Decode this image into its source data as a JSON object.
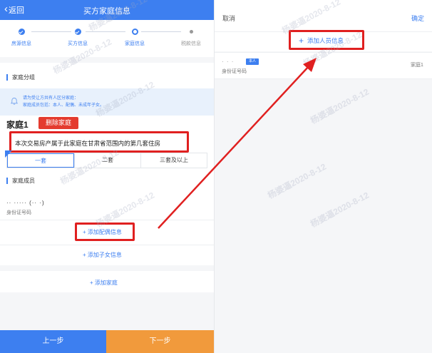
{
  "left": {
    "nav": {
      "back_label": "返回",
      "title": "买方家庭信息"
    },
    "steps": [
      {
        "label": "房源信息",
        "state": "done"
      },
      {
        "label": "买方信息",
        "state": "done"
      },
      {
        "label": "家庭信息",
        "state": "current"
      },
      {
        "label": "税款信息",
        "state": "todo"
      }
    ],
    "family_group_title": "家庭分组",
    "notice": {
      "line1": "请为受让方共有人区分家庭：",
      "line2": "家庭成员包括：本人、配偶、未成年子女。"
    },
    "family_name": "家庭1",
    "delete_family_label": "删除家庭",
    "question": "本次交易房产属于此家庭在甘肃省范围内的第几套住房",
    "options": [
      "一套",
      "二套",
      "三套及以上"
    ],
    "selected_option": "一套",
    "members_title": "家庭成员",
    "member": {
      "name": "·· ·····  (·· ·)",
      "id_label": "身份证号码"
    },
    "add_spouse_label": "+ 添加配偶信息",
    "add_child_label": "+ 添加子女信息",
    "add_family_label": "+ 添加家庭",
    "prev_label": "上一步",
    "next_label": "下一步"
  },
  "right": {
    "cancel_label": "取消",
    "confirm_label": "确定",
    "add_person_label": "添加人员信息",
    "person": {
      "name": "· ·  ·",
      "tag": "本人",
      "id_label": "身份证号码",
      "family": "家庭1"
    }
  },
  "watermark": "杨婆逼2020-8-12",
  "colors": {
    "primary": "#3d7ff0",
    "danger": "#e43b2f",
    "highlight_box": "#e02020",
    "next_button": "#f19a3c"
  }
}
